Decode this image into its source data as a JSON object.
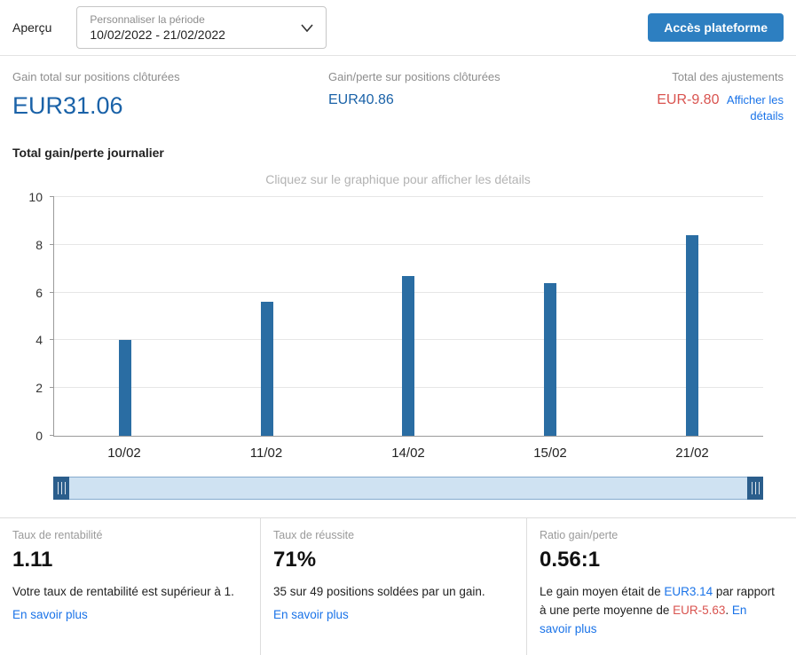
{
  "header": {
    "overview_label": "Aperçu",
    "period_selector": {
      "label": "Personnaliser la période",
      "value": "10/02/2022 - 21/02/2022"
    },
    "platform_button": "Accès plateforme"
  },
  "summary": {
    "total_gain": {
      "label": "Gain total sur positions clôturées",
      "value": "EUR31.06"
    },
    "gain_loss": {
      "label": "Gain/perte sur positions clôturées",
      "value": "EUR40.86"
    },
    "adjustments": {
      "label": "Total des ajustements",
      "value": "EUR-9.80",
      "link": "Afficher les détails"
    }
  },
  "chart": {
    "title": "Total gain/perte journalier",
    "hint": "Cliquez sur le graphique pour afficher les détails"
  },
  "chart_data": {
    "type": "bar",
    "title": "Total gain/perte journalier",
    "categories": [
      "10/02",
      "11/02",
      "14/02",
      "15/02",
      "21/02"
    ],
    "values": [
      4.0,
      5.6,
      6.7,
      6.4,
      8.4
    ],
    "xlabel": "",
    "ylabel": "",
    "ylim": [
      0,
      10
    ],
    "yticks": [
      0,
      2,
      4,
      6,
      8,
      10
    ],
    "grid": true,
    "legend": false,
    "bar_color": "#2a6da3"
  },
  "cards": [
    {
      "label": "Taux de rentabilité",
      "value": "1.11",
      "desc": "Votre taux de rentabilité est supérieur à 1.",
      "link": "En savoir plus"
    },
    {
      "label": "Taux de réussite",
      "value": "71%",
      "desc": "35 sur 49 positions soldées par un gain.",
      "link": "En savoir plus"
    },
    {
      "label": "Ratio gain/perte",
      "value": "0.56:1",
      "desc_parts": {
        "p1": "Le gain moyen était de ",
        "v1": "EUR3.14",
        "p2": " par rapport à une perte moyenne de ",
        "v2": "EUR-5.63",
        "p3": ". "
      },
      "link": "En savoir plus"
    }
  ],
  "colors": {
    "accent_blue": "#2d7fc1",
    "value_blue": "#1a62a8",
    "link_blue": "#1a73e8",
    "negative_red": "#d9534f",
    "bar_blue": "#2a6da3"
  }
}
